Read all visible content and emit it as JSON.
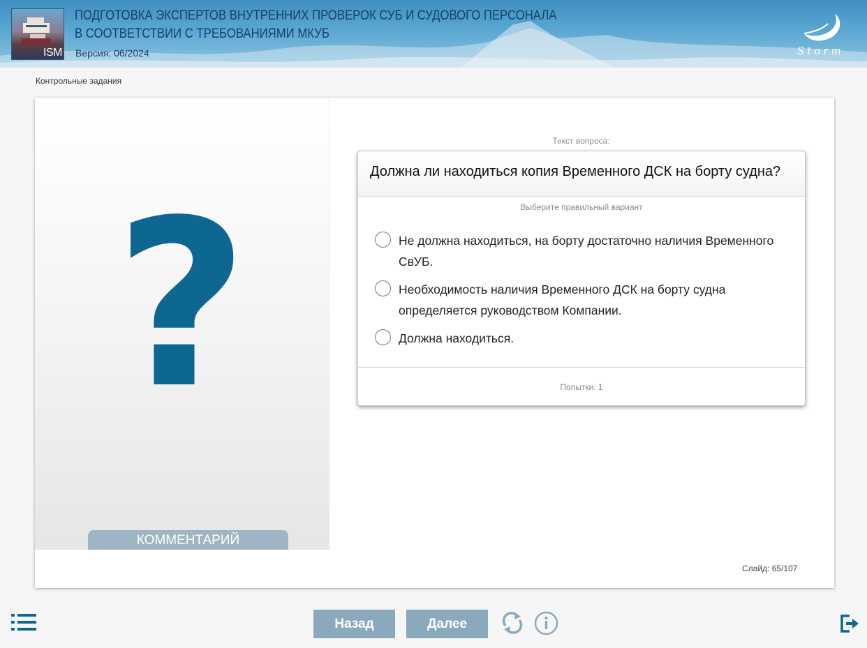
{
  "header": {
    "title_line1": "ПОДГОТОВКА ЭКСПЕРТОВ ВНУТРЕННИХ ПРОВЕРОК СУБ И СУДОВОГО ПЕРСОНАЛА",
    "title_line2": "В СООТВЕТСТВИИ С ТРЕБОВАНИЯМИ МКУБ",
    "version": "Версия: 06/2024",
    "logo_text": "ISM",
    "brand": "Storm"
  },
  "breadcrumb": "Контрольные задания",
  "left_panel": {
    "symbol": "?",
    "comment_tab": "КОММЕНТАРИЙ"
  },
  "question": {
    "caption": "Текст вопроса:",
    "text": "Должна ли находиться копия Временного ДСК на борту судна?",
    "hint": "Выберите правильный вариант",
    "options": [
      {
        "label": "Не должна находиться, на борту достаточно наличия Временного СвУБ.",
        "selected": false
      },
      {
        "label": "Необходимость наличия Временного ДСК на борту судна определяется руководством Компании.",
        "selected": false
      },
      {
        "label": "Должна находиться.",
        "selected": false
      }
    ],
    "attempts": "Попытки: 1"
  },
  "slide": "Слайд:  65/107",
  "nav": {
    "back_label": "Назад",
    "next_label": "Далее",
    "icons": [
      "menu-icon",
      "reload-icon",
      "info-icon",
      "exit-icon"
    ]
  },
  "colors": {
    "accent": "#0e6791",
    "button": "#8ba9bd",
    "comment_tab": "#9eb6c3",
    "title": "#14406b"
  }
}
